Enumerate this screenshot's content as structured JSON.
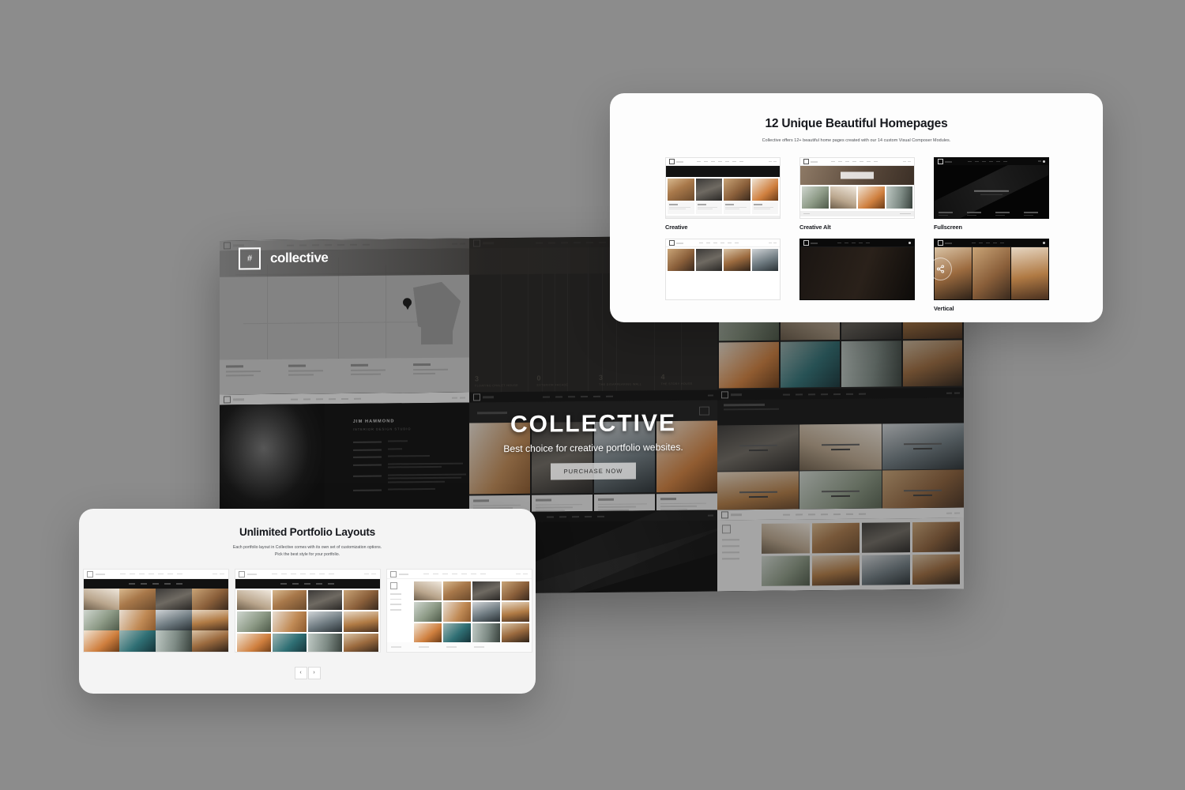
{
  "background_color": "#8c8c8c",
  "mockup": {
    "brand": {
      "logo_glyph": "#",
      "logo_text": "collective"
    },
    "nav_items": [
      "HOME",
      "WORK",
      "SERVICES",
      "AGENCY",
      "BLOG",
      "CONTACT",
      "SHOP"
    ],
    "hero": {
      "title": "COLLECTIVE",
      "subtitle": "Best choice for creative portfolio websites.",
      "cta_label": "PURCHASE NOW"
    },
    "share_icon": "share-icon",
    "portrait_panel": {
      "name": "JIM HAMMOND",
      "role": "INTERIOR DESIGN STUDIO"
    },
    "stripe_captions": [
      {
        "num": "3",
        "text": "FLOATING CHALET HOUSE"
      },
      {
        "num": "0",
        "text": "EXTERIOR FACADE"
      },
      {
        "num": "3",
        "text": "THE DISAPPEARING WALL"
      },
      {
        "num": "4",
        "text": "THE STORY HOUSE"
      }
    ]
  },
  "homepages_card": {
    "title": "12 Unique Beautiful Homepages",
    "subtitle": "Collective offers 12+ beautiful home pages created with our 14 custom Visual Composer Modules.",
    "items": [
      {
        "label": "Creative",
        "style": "light"
      },
      {
        "label": "Creative Alt",
        "style": "light-hero"
      },
      {
        "label": "Fullscreen",
        "style": "dark"
      },
      {
        "label": "Vertical",
        "style": "dark"
      }
    ]
  },
  "layouts_card": {
    "title": "Unlimited Portfolio Layouts",
    "subtitle_line1": "Each portfolio layout in Collective comes with its own set of customization options.",
    "subtitle_line2": "Pick the best style for your portfolio.",
    "prev_label": "‹",
    "next_label": "›",
    "thumbnails": [
      "masonry-full-bleed",
      "grid-four-column",
      "grid-with-sidebar"
    ]
  }
}
